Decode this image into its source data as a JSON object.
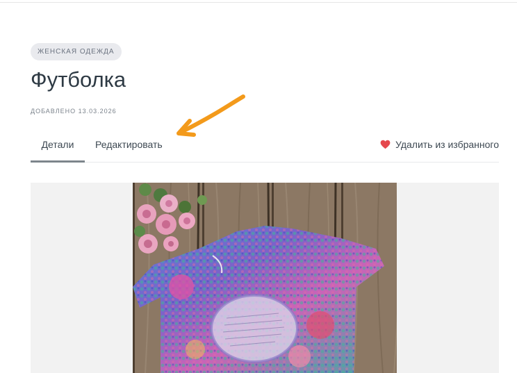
{
  "category_badge": "ЖЕНСКАЯ ОДЕЖДА",
  "product": {
    "title": "Футболка",
    "added": "ДОБАВЛЕНО 13.03.2026"
  },
  "tabs": [
    {
      "label": "Детали",
      "active": true
    },
    {
      "label": "Редактировать",
      "active": false
    }
  ],
  "favorite": {
    "label": "Удалить из избранного",
    "icon": "heart-icon",
    "color": "#e5484d"
  },
  "annotation": {
    "icon": "arrow-annotation-icon",
    "color": "#f39a1b"
  },
  "image": {
    "subject": "product-photo-tshirt"
  }
}
